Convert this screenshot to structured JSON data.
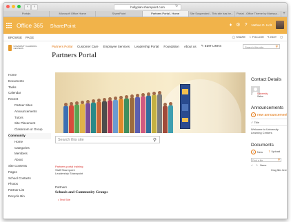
{
  "browser": {
    "url": "hollyplan.sharepoint.com",
    "tabs": [
      "Portals",
      "Microsoft Office Home",
      "SharePoint",
      "Partners Portal - Home",
      "Site Suspended - This site has be...",
      "Portal - Office Theme by Marissa..."
    ],
    "active_tab_index": 3
  },
  "suite": {
    "brand": "Office 365",
    "app": "SharePoint",
    "user_name": "Nathan D. Holt"
  },
  "ribbon": {
    "tabs": [
      "BROWSE",
      "PAGE"
    ],
    "actions": [
      "SHARE",
      "FOLLOW",
      "EDIT"
    ]
  },
  "site": {
    "logo_text": "UNIVERSITY LEARNING CENTERS",
    "nav": [
      "Partners Portal",
      "Customer Care",
      "Employee Services",
      "Leadership Portal",
      "Foundation",
      "About us",
      "EDIT LINKS"
    ],
    "search_placeholder": "Search this site",
    "title": "Partners Portal"
  },
  "left_nav": [
    {
      "label": "Home",
      "sub": false
    },
    {
      "label": "Documents",
      "sub": false
    },
    {
      "label": "Tasks",
      "sub": false
    },
    {
      "label": "Calendar",
      "sub": false
    },
    {
      "label": "Recent",
      "sub": false
    },
    {
      "label": "Partner Sites",
      "sub": true
    },
    {
      "label": "Announcements",
      "sub": true
    },
    {
      "label": "Tutors",
      "sub": true
    },
    {
      "label": "Site Placement",
      "sub": true
    },
    {
      "label": "Classroom or Group",
      "sub": true
    },
    {
      "label": "Community",
      "sub": false,
      "selected": true
    },
    {
      "label": "Home",
      "sub": true
    },
    {
      "label": "Categories",
      "sub": true
    },
    {
      "label": "Members",
      "sub": true
    },
    {
      "label": "About",
      "sub": true
    },
    {
      "label": "Site Contents",
      "sub": false
    },
    {
      "label": "Pages",
      "sub": false
    },
    {
      "label": "School Contacts",
      "sub": false
    },
    {
      "label": "Photos",
      "sub": false
    },
    {
      "label": "Partner List",
      "sub": false
    },
    {
      "label": "Recycle Bin",
      "sub": false
    }
  ],
  "main": {
    "search_placeholder": "Search this site",
    "links": [
      "Partners portal training",
      "Staff Sharepoint",
      "Leadership Sharepoint"
    ],
    "section_label": "Partners",
    "section_heading": "Schools and Community Groups",
    "list_item": "Test Site"
  },
  "side": {
    "contact_heading": "Contact Details",
    "contact_lines": [
      "University",
      "Sales"
    ],
    "announcements_heading": "Announcements",
    "new_announcement": "new announcement",
    "col_title": "Title",
    "announcement_text": "Welcome to University Learning Centers",
    "documents_heading": "Documents",
    "new_label": "New",
    "upload_label": "Upload",
    "find_placeholder": "Find a file",
    "col_name": "Name",
    "drag_text": "Drag files here"
  },
  "colors": {
    "suite_bar": "#f1b34a",
    "accent": "#e2730b",
    "link_red": "#d9302c"
  }
}
